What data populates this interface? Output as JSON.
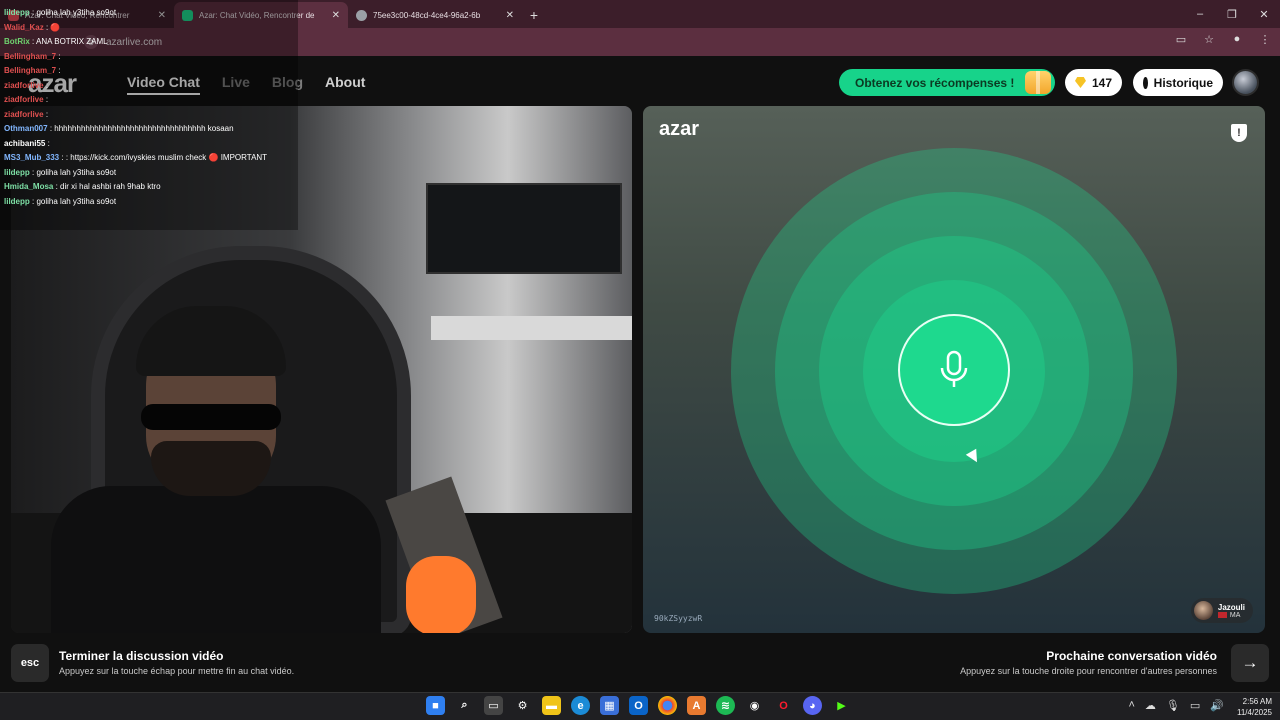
{
  "browser": {
    "tabs": [
      {
        "title": "Azar: Chat Vidéo, Rencontrer",
        "color": "#e94c57"
      },
      {
        "title": "Azar: Chat Vidéo, Rencontrer de",
        "color": "#1ed98e"
      },
      {
        "title": "75ee3c00-48cd-4ce4-96a2-6b",
        "color": "#9aa0a6"
      }
    ],
    "new_tab": "+",
    "url": "azarlive.com"
  },
  "nav": {
    "logo": "azar",
    "links": [
      "Video Chat",
      "Live",
      "Blog",
      "About"
    ],
    "rewards": "Obtenez vos récompenses !",
    "gems": "147",
    "history": "Historique"
  },
  "chat": [
    {
      "user": "lildepp",
      "text": ": goliha lah y3tiha so9ot",
      "color": "#7ee1a6"
    },
    {
      "user": "Walid_Kaz",
      "text": ": 🔴",
      "color": "#e05050"
    },
    {
      "user": "BotRix",
      "text": ": ANA BOTRIX ZAML",
      "color": "#6fd36f"
    },
    {
      "user": "Bellingham_7",
      "text": ":",
      "color": "#e05050"
    },
    {
      "user": "Bellingham_7",
      "text": ":",
      "color": "#e05050"
    },
    {
      "user": "ziadforlive",
      "text": ":",
      "color": "#e05050"
    },
    {
      "user": "ziadforlive",
      "text": ":",
      "color": "#e05050"
    },
    {
      "user": "ziadforlive",
      "text": ":",
      "color": "#e05050"
    },
    {
      "user": "Othman007",
      "text": ": hhhhhhhhhhhhhhhhhhhhhhhhhhhhhhhhhh kosaan",
      "color": "#82b7ff"
    },
    {
      "user": "achibani55",
      "text": ":",
      "color": "#ffffff"
    },
    {
      "user": "MS3_Mub_333",
      "text": ": : https://kick.com/ivyskies muslim check 🔴 IMPORTANT",
      "color": "#82b7ff"
    },
    {
      "user": "lildepp",
      "text": ": goliha lah y3tiha so9ot",
      "color": "#7ee1a6"
    },
    {
      "user": "Hmida_Mosa",
      "text": ": dir xi hal ashbi rah 9hab ktro",
      "color": "#7ee1a6"
    },
    {
      "user": "lildepp",
      "text": ": goliha lah y3tiha so9ot",
      "color": "#7ee1a6"
    }
  ],
  "remote": {
    "logo": "azar",
    "code": "90kZSyyzwR",
    "partner_name": "Jazouli",
    "partner_country": "MA"
  },
  "footer": {
    "esc": "esc",
    "left_title": "Terminer la discussion vidéo",
    "left_sub": "Appuyez sur la touche échap pour mettre fin au chat vidéo.",
    "right_title": "Prochaine conversation vidéo",
    "right_sub": "Appuyez sur la touche droite pour rencontrer d'autres personnes",
    "next_icon": "→"
  },
  "taskbar": {
    "time": "2:56 AM",
    "date": "11/4/2025"
  },
  "colors": {
    "accent": "#1ed98e",
    "gem": "#f6c325"
  }
}
